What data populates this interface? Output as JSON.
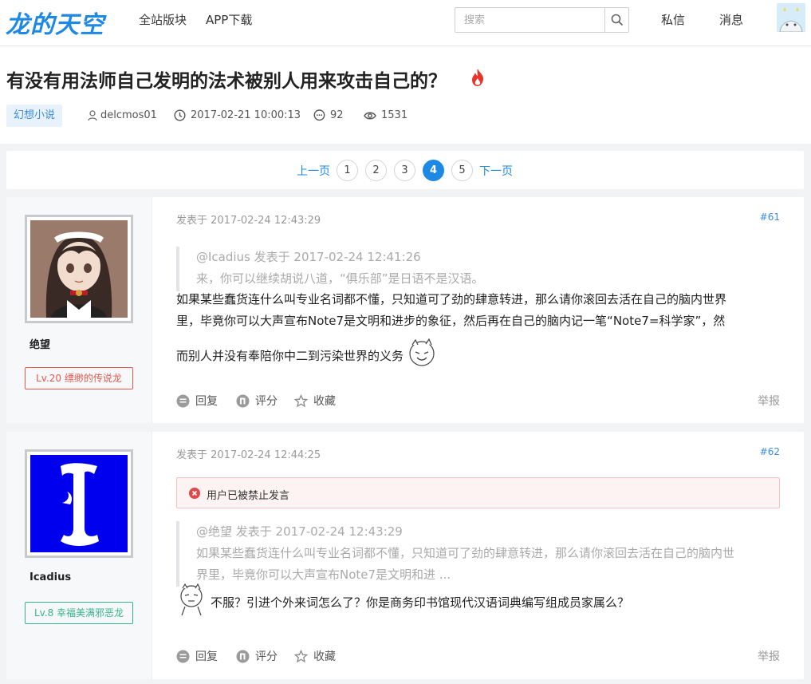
{
  "header": {
    "logo": "龙的天空",
    "nav": [
      "全站版块",
      "APP下载"
    ],
    "search_placeholder": "搜索",
    "messages": "私信",
    "notifications": "消息"
  },
  "thread": {
    "title": "有没有用法师自己发明的法术被别人用来攻击自己的？",
    "tag": "幻想小说",
    "author": "delcmos01",
    "datetime": "2017-02-21 10:00:13",
    "replies": "92",
    "views": "1531"
  },
  "pager": {
    "prev": "上一页",
    "pages": [
      "1",
      "2",
      "3",
      "4",
      "5"
    ],
    "current": "4",
    "next": "下一页"
  },
  "posts": [
    {
      "username": "绝望",
      "level": "Lv.20 缥缈的传说龙",
      "time": "发表于 2017-02-24 12:43:29",
      "floor": "#61",
      "quote_head": "@Icadius 发表于 2017-02-24 12:41:26",
      "quote_body": "来，你可以继续胡说八道，“俱乐部”是日语不是汉语。",
      "body_line1": "如果某些蠢货连什么叫专业名词都不懂，只知道可了劲的肆意转进，那么请你滚回去活在自己的脑内世界",
      "body_line2": "里，毕竟你可以大声宣布Note7是文明和进步的象征，然后再在自己的脑内记一笔“Note7=科学家”，然",
      "body_line3": "而别人并没有奉陪你中二到污染世界的义务"
    },
    {
      "username": "Icadius",
      "level": "Lv.8 幸福美满邪恶龙",
      "time": "发表于 2017-02-24 12:44:25",
      "floor": "#62",
      "banned": "用户已被禁止发言",
      "quote_head": "@绝望 发表于 2017-02-24 12:43:29",
      "quote_body1": "如果某些蠢货连什么叫专业名词都不懂，只知道可了劲的肆意转进，那么请你滚回去活在自己的脑内世",
      "quote_body2": "界里，毕竟你可以大声宣布Note7是文明和进 ...",
      "body_line1": "不服？引进个外来词怎么了？你是商务印书馆现代汉语词典编写组成员家属么？"
    }
  ],
  "actions": {
    "reply": "回复",
    "rate": "评分",
    "favorite": "收藏",
    "report": "举报"
  },
  "colors": {
    "accent": "#1e88e5",
    "level_high": "#e05a4e",
    "level_low": "#34b48a",
    "banned_bg": "#fdf3f3"
  }
}
